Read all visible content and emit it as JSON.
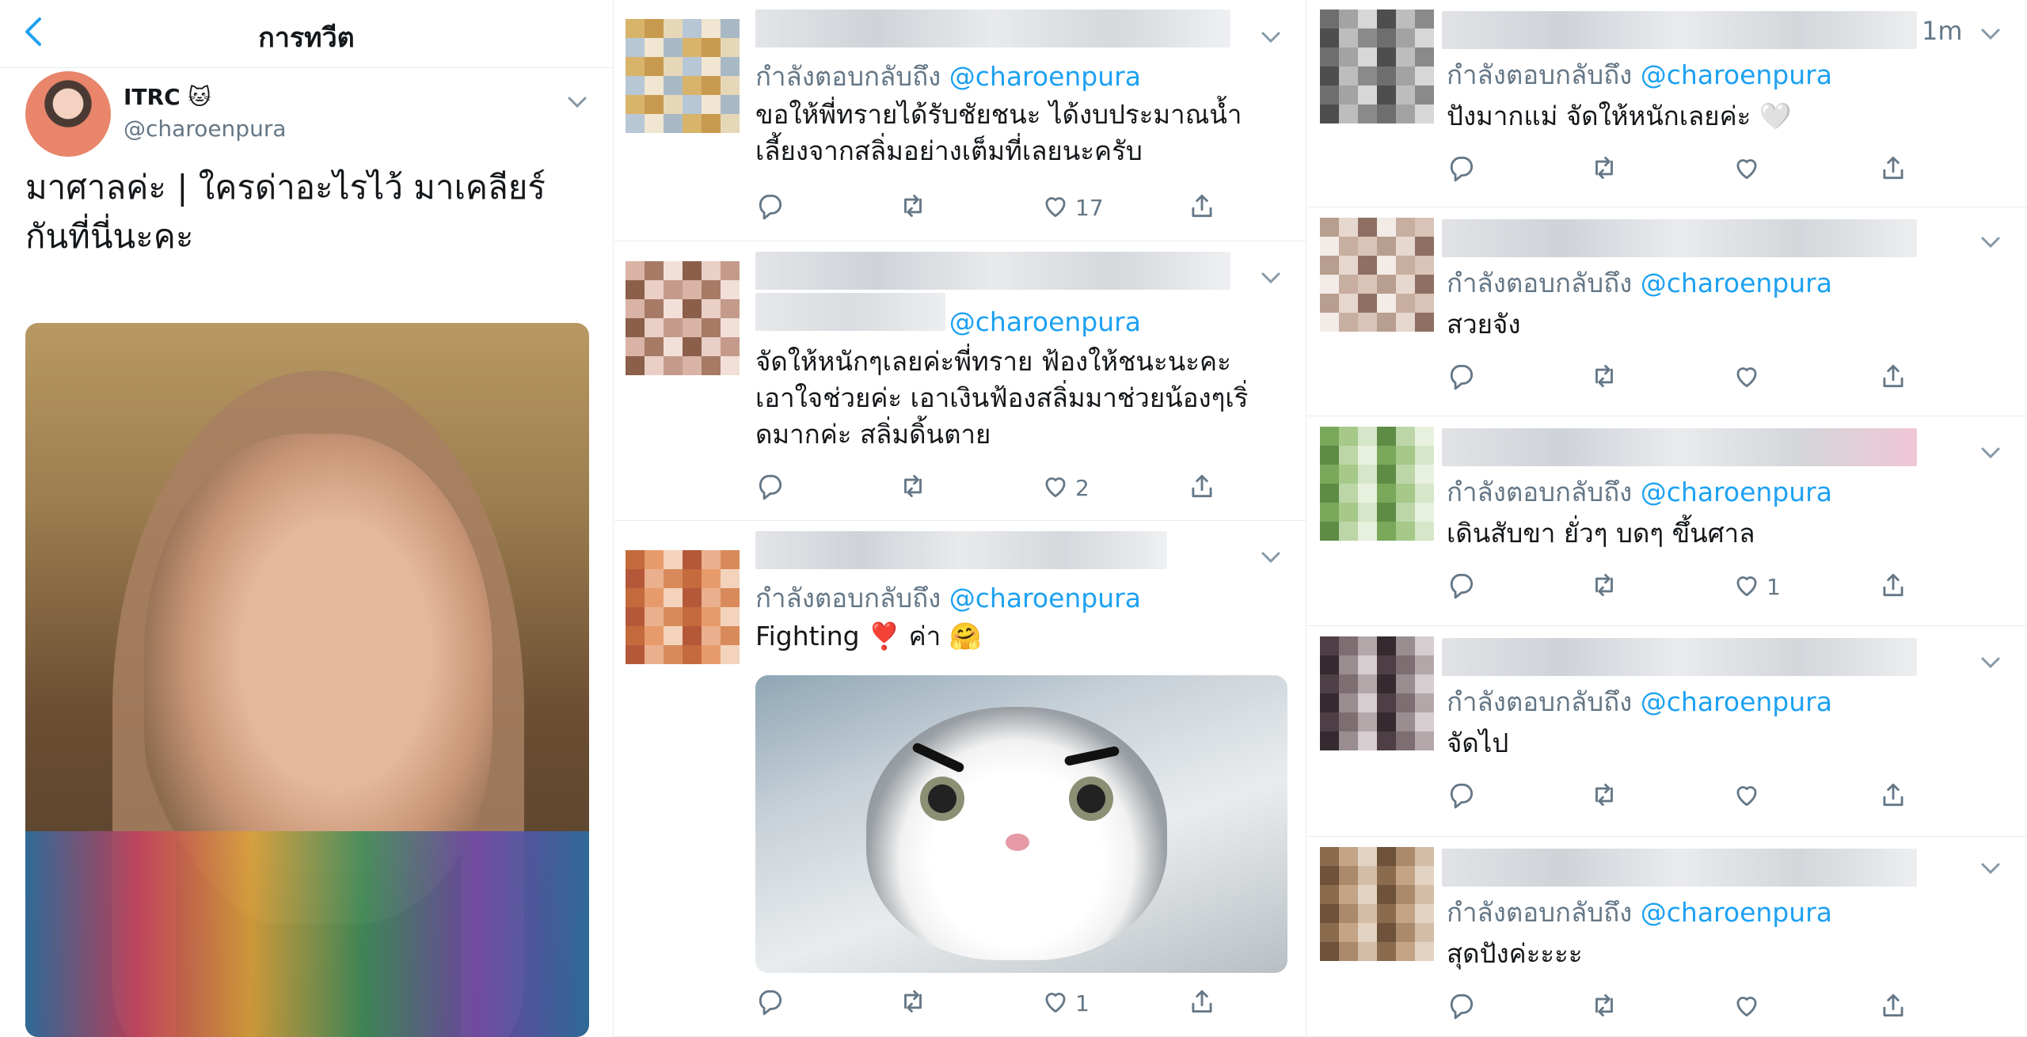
{
  "main": {
    "header_title": "การทวีต",
    "author_name": "ITRC 🐱",
    "author_handle": "@charoenpura",
    "tweet_text": "มาศาลค่ะ | ใครด่าอะไรไว้ มาเคลียร์กันที่นี่นะคะ"
  },
  "replying_prefix": "กำลังตอบกลับถึง",
  "mention": "@charoenpura",
  "replies_middle": [
    {
      "text": "ขอให้พี่ทรายได้รับชัยชนะ ได้งบประมาณน้ำเลี้ยงจากสลิ่มอย่างเต็มที่เลยนะครับ",
      "likes": "17"
    },
    {
      "text": "จัดให้หนักๆเลยค่ะพี่ทราย ฟ้องให้ชนะนะคะ เอาใจช่วยค่ะ เอาเงินฟ้องสลิ่มมาช่วยน้องๆเริ่ดมากค่ะ สลิ่มดิ้นตาย",
      "likes": "2"
    },
    {
      "text": "Fighting ❣️ ค่า 🤗",
      "likes": "1"
    }
  ],
  "replies_right": [
    {
      "timestamp": "1m",
      "text": "ปังมากแม่ จัดให้หนักเลยค่ะ 🤍",
      "likes": ""
    },
    {
      "text": "สวยจัง",
      "likes": ""
    },
    {
      "text": "เดินสับขา ยั่วๆ บดๆ ขึ้นศาล",
      "likes": "1"
    },
    {
      "text": "จัดไป",
      "likes": ""
    },
    {
      "text": "สุดปังค่ะะะะ",
      "likes": ""
    }
  ],
  "colors": {
    "accent": "#1da1f2",
    "muted": "#657786",
    "text": "#14171a",
    "divider": "#e6ecf0"
  },
  "icons": [
    "back-arrow-icon",
    "chevron-down-icon",
    "reply-icon",
    "retweet-icon",
    "like-icon",
    "share-icon"
  ]
}
